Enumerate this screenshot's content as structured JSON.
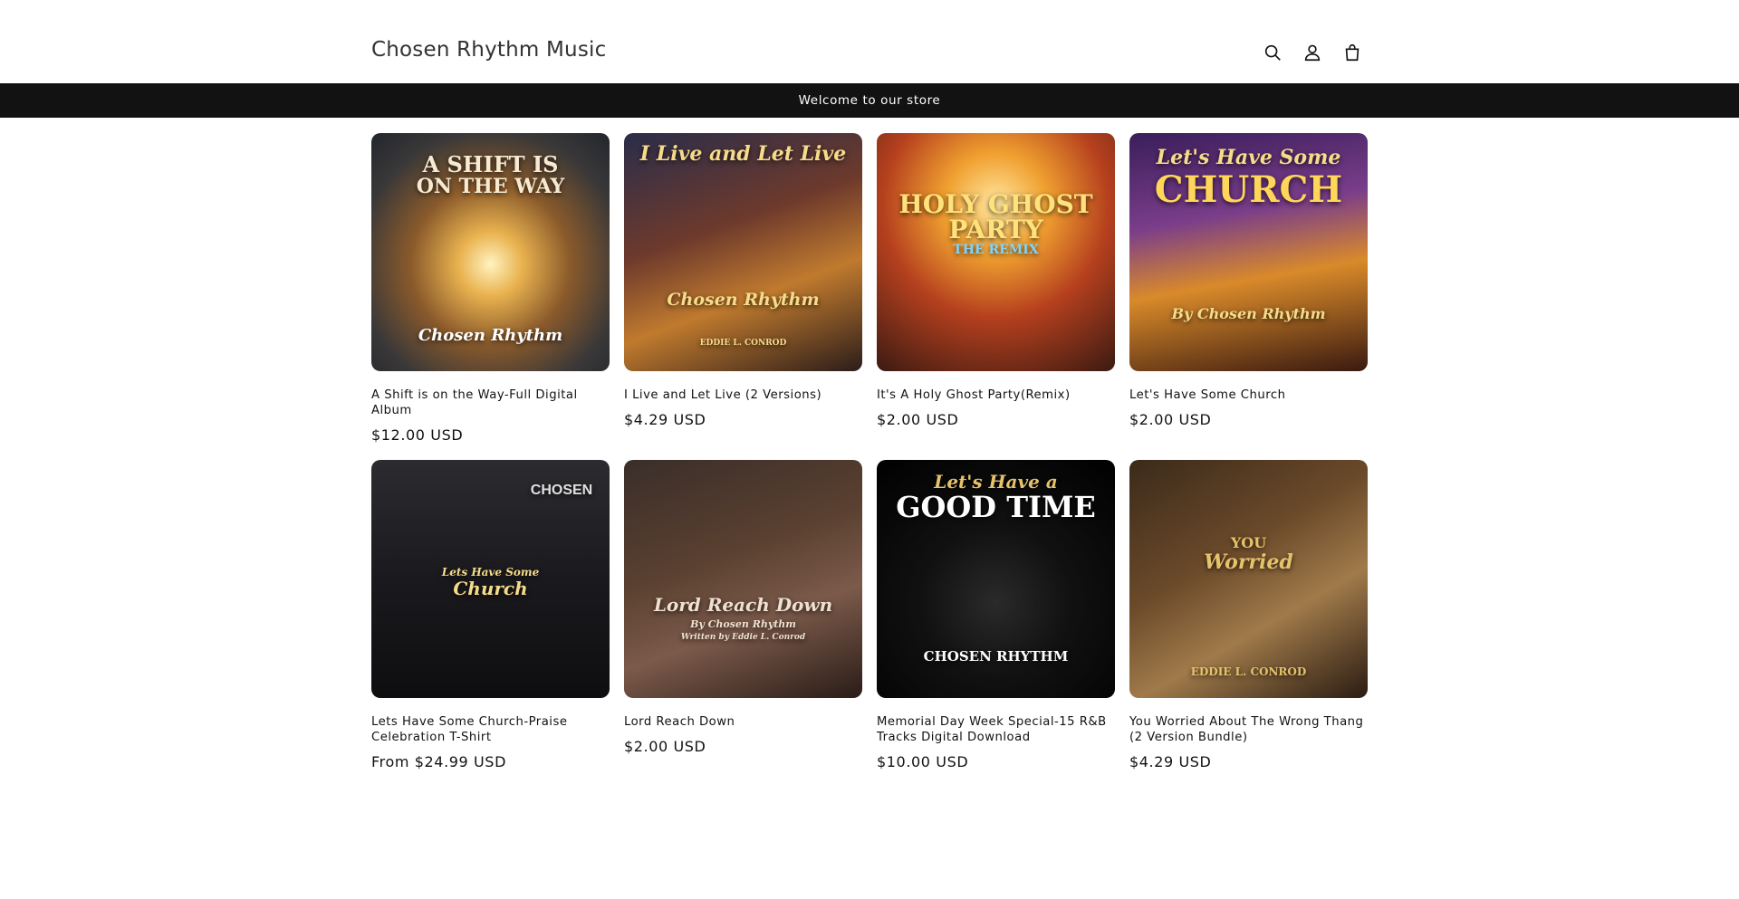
{
  "header": {
    "logo": "Chosen Rhythm Music",
    "icons": [
      "search-icon",
      "account-icon",
      "cart-icon"
    ]
  },
  "announcement": "Welcome to our store",
  "products": [
    {
      "title": "A Shift is on the Way-Full Digital Album",
      "price": "$12.00 USD",
      "art": {
        "line1": "A SHIFT IS",
        "line2": "ON THE WAY",
        "line3": "Chosen Rhythm"
      }
    },
    {
      "title": "I Live and Let Live (2 Versions)",
      "price": "$4.29 USD",
      "art": {
        "line1": "I Live and Let Live",
        "line2": "Chosen Rhythm",
        "line3": "EDDIE L. CONROD"
      }
    },
    {
      "title": "It's A Holy Ghost Party(Remix)",
      "price": "$2.00 USD",
      "art": {
        "line1": "HOLY GHOST",
        "line2": "PARTY",
        "line3": "THE REMIX"
      }
    },
    {
      "title": "Let's Have Some Church",
      "price": "$2.00 USD",
      "art": {
        "line1": "Let's Have Some",
        "line2": "CHURCH",
        "line3": "By Chosen Rhythm"
      }
    },
    {
      "title": "Lets Have Some Church-Praise Celebration T-Shirt",
      "price": "From $24.99 USD",
      "art": {
        "line1": "CHOSEN",
        "line2": "Lets Have Some",
        "line3": "Church"
      }
    },
    {
      "title": "Lord Reach Down",
      "price": "$2.00 USD",
      "art": {
        "line1": "Lord Reach Down",
        "line2": "By Chosen Rhythm",
        "line3": "Written by Eddie L. Conrod"
      }
    },
    {
      "title": "Memorial Day Week Special-15 R&B Tracks Digital Download",
      "price": "$10.00 USD",
      "art": {
        "line1": "Let's Have a",
        "line2": "GOOD TIME",
        "line3": "CHOSEN RHYTHM"
      }
    },
    {
      "title": "You Worried About The Wrong Thang (2 Version Bundle)",
      "price": "$4.29 USD",
      "art": {
        "line1": "YOU",
        "line2": "Worried",
        "line3": "EDDIE L. CONROD"
      }
    }
  ]
}
